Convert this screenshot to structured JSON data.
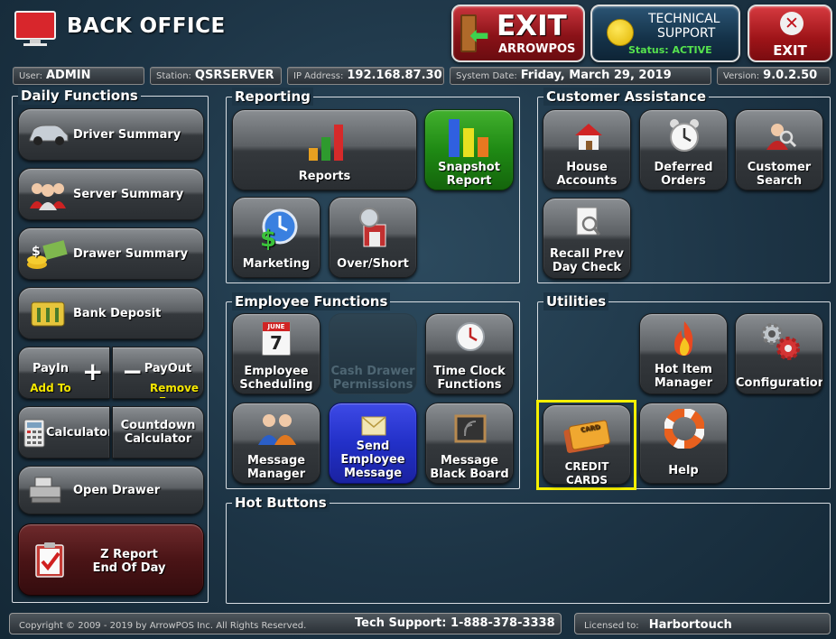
{
  "header": {
    "title": "BACK OFFICE",
    "exit_arrow": {
      "big": "EXIT",
      "sub": "ARROWPOS"
    },
    "tech": {
      "line1": "TECHNICAL",
      "line2": "SUPPORT",
      "status": "Status: ACTIVE"
    },
    "exit_label": "EXIT"
  },
  "status": {
    "user_label": "User:",
    "user": "ADMIN",
    "station_label": "Station:",
    "station": "QSRSERVER",
    "ip_label": "IP Address:",
    "ip": "192.168.87.30",
    "date_label": "System Date:",
    "date": "Friday, March 29, 2019",
    "version_label": "Version:",
    "version": "9.0.2.50"
  },
  "panels": {
    "daily": "Daily Functions",
    "reporting": "Reporting",
    "customer": "Customer Assistance",
    "employee": "Employee Functions",
    "utilities": "Utilities",
    "hot": "Hot Buttons"
  },
  "daily": {
    "driver": "Driver Summary",
    "server": "Server Summary",
    "drawer": "Drawer Summary",
    "bank": "Bank Deposit",
    "payin": "PayIn",
    "payin_sub": "Add To",
    "payout": "PayOut",
    "payout_sub": "Remove From",
    "calculator": "Calculator",
    "countdown1": "Countdown",
    "countdown2": "Calculator",
    "open_drawer": "Open Drawer",
    "z1": "Z Report",
    "z2": "End Of Day"
  },
  "reporting": {
    "reports": "Reports",
    "snapshot1": "Snapshot",
    "snapshot2": "Report",
    "marketing": "Marketing",
    "overshort": "Over/Short"
  },
  "customer": {
    "house1": "House",
    "house2": "Accounts",
    "deferred1": "Deferred",
    "deferred2": "Orders",
    "search1": "Customer",
    "search2": "Search",
    "recall1": "Recall Prev",
    "recall2": "Day Check"
  },
  "employee": {
    "sched1": "Employee",
    "sched2": "Scheduling",
    "cash1": "Cash Drawer",
    "cash2": "Permissions",
    "clock1": "Time Clock",
    "clock2": "Functions",
    "msgmgr1": "Message",
    "msgmgr2": "Manager",
    "send1": "Send",
    "send2": "Employee",
    "send3": "Message",
    "board1": "Message",
    "board2": "Black Board",
    "calendar_month": "JUNE",
    "calendar_day": "7"
  },
  "utilities": {
    "hotitem1": "Hot Item",
    "hotitem2": "Manager",
    "config": "Configuration",
    "cards": "CREDIT CARDS",
    "cards_icon_text": "CARD",
    "help": "Help"
  },
  "footer": {
    "copyright": "Copyright © 2009 - 2019 by ArrowPOS Inc. All Rights Reserved.",
    "support": "Tech Support: 1-888-378-3338",
    "licensed_label": "Licensed to:",
    "licensed": "Harbortouch"
  },
  "colors": {
    "highlight": "#f6f000",
    "status_active": "#56e34e"
  }
}
